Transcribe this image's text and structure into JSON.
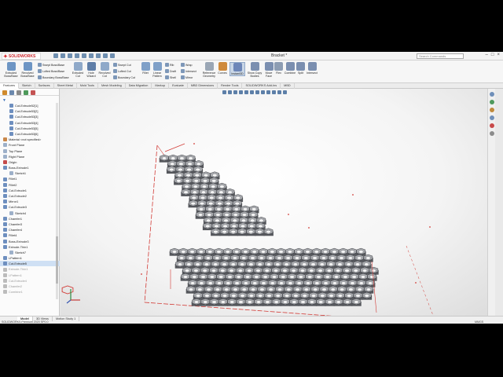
{
  "window": {
    "logo_text": "SOLIDWORKS",
    "document_title": "Bracket *",
    "search_placeholder": "Search Commands"
  },
  "ribbon": {
    "large": [
      {
        "label": "Extruded Boss/Base",
        "color": "#6d95c4"
      },
      {
        "label": "Revolved Boss/Base",
        "color": "#6d95c4"
      },
      {
        "label": "Extruded Cut",
        "color": "#8fa9c9"
      },
      {
        "label": "Hole Wizard",
        "color": "#5f7ea8"
      },
      {
        "label": "Revolved Cut",
        "color": "#8fa9c9"
      },
      {
        "label": "Fillet",
        "color": "#7fa0c8"
      },
      {
        "label": "Linear Pattern",
        "color": "#7fa0c8"
      },
      {
        "label": "Reference Geometry",
        "color": "#9aa6b5"
      },
      {
        "label": "Curves",
        "color": "#cf8a3c"
      },
      {
        "label": "Instant3D",
        "color": "#6d86b8"
      },
      {
        "label": "Show Copy Bodies",
        "color": "#7b8fb0"
      },
      {
        "label": "Move Face",
        "color": "#7b8fb0"
      },
      {
        "label": "Flex",
        "color": "#8d9db3"
      },
      {
        "label": "Combine",
        "color": "#7b8fb0"
      },
      {
        "label": "Split",
        "color": "#7b8fb0"
      },
      {
        "label": "Intersect",
        "color": "#7b8fb0"
      }
    ],
    "small": [
      "Swept Boss/Base",
      "Lofted Boss/Base",
      "Boundary Boss/Base",
      "Swept Cut",
      "Lofted Cut",
      "Boundary Cut",
      "Rib",
      "Draft",
      "Shell",
      "Wrap",
      "Intersect",
      "Mirror"
    ]
  },
  "tabs": [
    "Features",
    "Sketch",
    "Surfaces",
    "Sheet Metal",
    "Mold Tools",
    "Mesh Modeling",
    "Data Migration",
    "Markup",
    "Evaluate",
    "MBD Dimensions",
    "Render Tools",
    "SOLIDWORKS Add-Ins",
    "MBD"
  ],
  "active_tab": "Features",
  "tree": [
    {
      "label": "Cut-Extrude52[1]",
      "state": "normal",
      "indent": 1,
      "icon": "#6e8fbf"
    },
    {
      "label": "Cut-Extrude53[2]",
      "state": "normal",
      "indent": 1,
      "icon": "#6e8fbf"
    },
    {
      "label": "Cut-Extrude53[3]",
      "state": "normal",
      "indent": 1,
      "icon": "#6e8fbf"
    },
    {
      "label": "Cut-Extrude53[4]",
      "state": "normal",
      "indent": 1,
      "icon": "#6e8fbf"
    },
    {
      "label": "Cut-Extrude53[5]",
      "state": "normal",
      "indent": 1,
      "icon": "#6e8fbf"
    },
    {
      "label": "Cut-Extrude53[6]",
      "state": "normal",
      "indent": 1,
      "icon": "#6e8fbf"
    },
    {
      "label": "Material <not specified>",
      "state": "normal",
      "indent": 0,
      "icon": "#c9874a"
    },
    {
      "label": "Front Plane",
      "state": "normal",
      "indent": 0,
      "icon": "#9db0c9"
    },
    {
      "label": "Top Plane",
      "state": "normal",
      "indent": 0,
      "icon": "#9db0c9"
    },
    {
      "label": "Right Plane",
      "state": "normal",
      "indent": 0,
      "icon": "#9db0c9"
    },
    {
      "label": "Origin",
      "state": "normal",
      "indent": 0,
      "icon": "#c44b4b"
    },
    {
      "label": "Boss-Extrude1",
      "state": "normal",
      "indent": 0,
      "icon": "#6e8fbf"
    },
    {
      "label": "Sketch1",
      "state": "normal",
      "indent": 1,
      "icon": "#9db0c9"
    },
    {
      "label": "Fillet1",
      "state": "normal",
      "indent": 0,
      "icon": "#6e8fbf"
    },
    {
      "label": "Fillet2",
      "state": "normal",
      "indent": 0,
      "icon": "#6e8fbf"
    },
    {
      "label": "Cut-Extrude1",
      "state": "normal",
      "indent": 0,
      "icon": "#6e8fbf"
    },
    {
      "label": "Cut-Extrude2",
      "state": "normal",
      "indent": 0,
      "icon": "#6e8fbf"
    },
    {
      "label": "Mirror1",
      "state": "normal",
      "indent": 0,
      "icon": "#6e8fbf"
    },
    {
      "label": "Cut-Extrude3",
      "state": "normal",
      "indent": 0,
      "icon": "#6e8fbf"
    },
    {
      "label": "Sketch4",
      "state": "normal",
      "indent": 1,
      "icon": "#9db0c9"
    },
    {
      "label": "Chamfer1",
      "state": "normal",
      "indent": 0,
      "icon": "#6e8fbf"
    },
    {
      "label": "Chamfer3",
      "state": "normal",
      "indent": 0,
      "icon": "#6e8fbf"
    },
    {
      "label": "Chamfer4",
      "state": "normal",
      "indent": 0,
      "icon": "#6e8fbf"
    },
    {
      "label": "Fillet4",
      "state": "normal",
      "indent": 0,
      "icon": "#6e8fbf"
    },
    {
      "label": "Boss-Extrude3",
      "state": "normal",
      "indent": 0,
      "icon": "#6e8fbf"
    },
    {
      "label": "Extrude-Thin1",
      "state": "normal",
      "indent": 0,
      "icon": "#6e8fbf"
    },
    {
      "label": "Sketch7",
      "state": "normal",
      "indent": 1,
      "icon": "#9db0c9"
    },
    {
      "label": "LPattern1",
      "state": "normal",
      "indent": 0,
      "icon": "#6e8fbf"
    },
    {
      "label": "Cut-Extrude5",
      "state": "selected",
      "indent": 0,
      "icon": "#6e8fbf"
    },
    {
      "label": "Extrude-Thin1",
      "state": "dim",
      "indent": 0,
      "icon": "#bcbcbc"
    },
    {
      "label": "LPattern1",
      "state": "dim",
      "indent": 0,
      "icon": "#bcbcbc"
    },
    {
      "label": "Cut-Extrude4",
      "state": "dim",
      "indent": 0,
      "icon": "#bcbcbc"
    },
    {
      "label": "Chamfer2",
      "state": "dim",
      "indent": 0,
      "icon": "#bcbcbc"
    },
    {
      "label": "Combine1",
      "state": "dim",
      "indent": 0,
      "icon": "#bcbcbc"
    }
  ],
  "status": {
    "tabs": [
      "Model",
      "3D Views",
      "Motion Study 1"
    ],
    "active": "Model",
    "product": "SOLIDWORKS Premium 2020 SP0.0",
    "units": "MMGS"
  },
  "colors": {
    "model_face": "#a7a9ad",
    "model_dark": "#55575c",
    "edge_highlight": "#d23a35",
    "accent": "#5d7fa8"
  }
}
